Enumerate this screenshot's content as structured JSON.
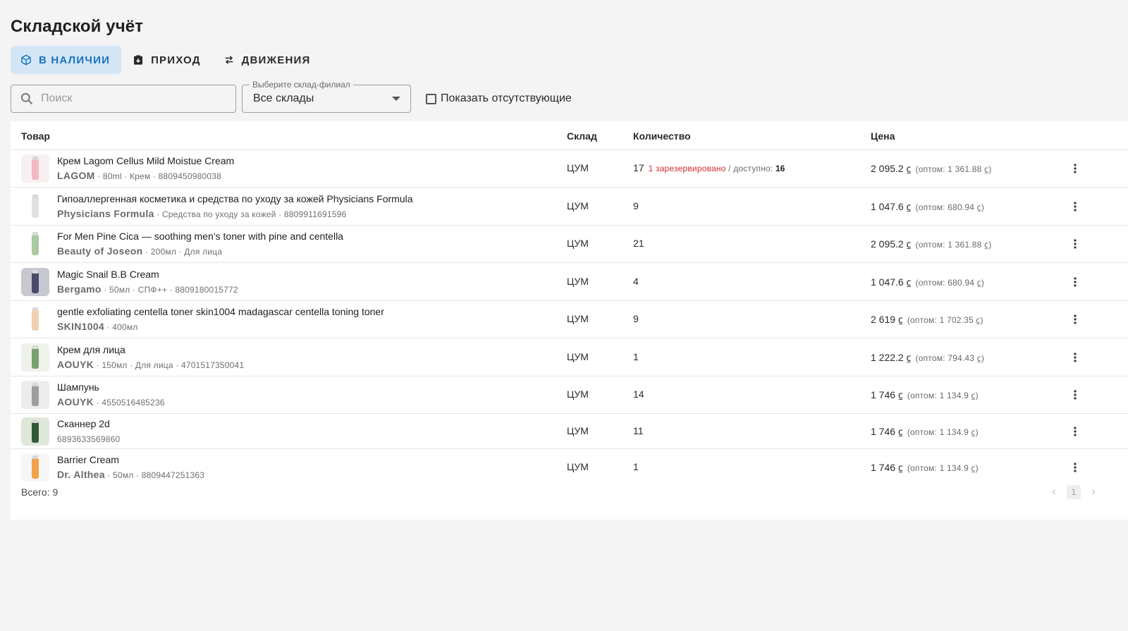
{
  "page": {
    "title": "Складской учёт"
  },
  "tabs": [
    {
      "label": "В НАЛИЧИИ",
      "icon": "box-icon",
      "active": true
    },
    {
      "label": "ПРИХОД",
      "icon": "clipboard-download-icon",
      "active": false
    },
    {
      "label": "ДВИЖЕНИЯ",
      "icon": "swap-arrows-icon",
      "active": false
    }
  ],
  "filters": {
    "search_placeholder": "Поиск",
    "warehouse_label": "Выберите склад-филиал",
    "warehouse_value": "Все склады",
    "show_missing_label": "Показать отсутствующие",
    "show_missing_checked": false
  },
  "table": {
    "headers": {
      "product": "Товар",
      "warehouse": "Склад",
      "quantity": "Количество",
      "price": "Цена"
    },
    "rows": [
      {
        "name": "Крем Lagom Cellus Mild Moistue Cream",
        "brand": "LAGOM",
        "meta": " · 80ml · Крем · 8809450980038",
        "warehouse": "ЦУМ",
        "qty": "17",
        "reserved": "1 зарезервировано",
        "avail_sep": " / доступно: ",
        "available": "16",
        "price": "2 095.2",
        "currency": "⃀",
        "wholesale_prefix": "(оптом: 1 361.88 ",
        "wholesale_suffix": ")",
        "thumb_color": "#f4b8c4",
        "thumb_bg": "#f6f0f0"
      },
      {
        "name": "Гипоаллергенная косметика и средства по уходу за кожей Physicians Formula",
        "brand": "Physicians Formula",
        "meta": " · Средства по уходу за кожей · 8809911691596",
        "warehouse": "ЦУМ",
        "qty": "9",
        "reserved": "",
        "avail_sep": "",
        "available": "",
        "price": "1 047.6",
        "currency": "⃀",
        "wholesale_prefix": "(оптом: 680.94 ",
        "wholesale_suffix": ")",
        "thumb_color": "#e0e0e0",
        "thumb_bg": "#ffffff"
      },
      {
        "name": "For Men Pine Cica — soothing men’s toner with pine and centella",
        "brand": "Beauty of Joseon",
        "meta": " · 200мл · Для лица",
        "warehouse": "ЦУМ",
        "qty": "21",
        "reserved": "",
        "avail_sep": "",
        "available": "",
        "price": "2 095.2",
        "currency": "⃀",
        "wholesale_prefix": "(оптом: 1 361.88 ",
        "wholesale_suffix": ")",
        "thumb_color": "#a9c9a0",
        "thumb_bg": "#ffffff"
      },
      {
        "name": "Magic Snail B.B Cream",
        "brand": "Bergamo",
        "meta": " · 50мл · СПФ++ · 8809180015772",
        "warehouse": "ЦУМ",
        "qty": "4",
        "reserved": "",
        "avail_sep": "",
        "available": "",
        "price": "1 047.6",
        "currency": "⃀",
        "wholesale_prefix": "(оптом: 680.94 ",
        "wholesale_suffix": ")",
        "thumb_color": "#4a4a6a",
        "thumb_bg": "#c8c8d0"
      },
      {
        "name": "gentle exfoliating centella toner skin1004 madagascar centella toning toner",
        "brand": "SKIN1004",
        "meta": " · 400мл",
        "warehouse": "ЦУМ",
        "qty": "9",
        "reserved": "",
        "avail_sep": "",
        "available": "",
        "price": "2 619",
        "currency": "⃀",
        "wholesale_prefix": "(оптом: 1 702.35 ",
        "wholesale_suffix": ")",
        "thumb_color": "#f0d0b0",
        "thumb_bg": "#ffffff"
      },
      {
        "name": "Крем для лица",
        "brand": "AOUYK",
        "meta": " · 150мл · Для лица · 4701517350041",
        "warehouse": "ЦУМ",
        "qty": "1",
        "reserved": "",
        "avail_sep": "",
        "available": "",
        "price": "1 222.2",
        "currency": "⃀",
        "wholesale_prefix": "(оптом: 794.43 ",
        "wholesale_suffix": ")",
        "thumb_color": "#7aa070",
        "thumb_bg": "#eef2ea"
      },
      {
        "name": "Шампунь",
        "brand": "AOUYK",
        "meta": " · 4550516485236",
        "warehouse": "ЦУМ",
        "qty": "14",
        "reserved": "",
        "avail_sep": "",
        "available": "",
        "price": "1 746",
        "currency": "⃀",
        "wholesale_prefix": "(оптом: 1 134.9 ",
        "wholesale_suffix": ")",
        "thumb_color": "#9e9e9e",
        "thumb_bg": "#ececec"
      },
      {
        "name": "Сканнер 2d",
        "brand": "",
        "meta": "6893633569860",
        "warehouse": "ЦУМ",
        "qty": "11",
        "reserved": "",
        "avail_sep": "",
        "available": "",
        "price": "1 746",
        "currency": "⃀",
        "wholesale_prefix": "(оптом: 1 134.9 ",
        "wholesale_suffix": ")",
        "thumb_color": "#2e5a3a",
        "thumb_bg": "#dfe8d8"
      },
      {
        "name": "Barrier Cream",
        "brand": "Dr. Althea",
        "meta": " · 50мл · 8809447251363",
        "warehouse": "ЦУМ",
        "qty": "1",
        "reserved": "",
        "avail_sep": "",
        "available": "",
        "price": "1 746",
        "currency": "⃀",
        "wholesale_prefix": "(оптом: 1 134.9 ",
        "wholesale_suffix": ")",
        "thumb_color": "#f2a04a",
        "thumb_bg": "#f6f6f6"
      }
    ]
  },
  "footer": {
    "total": "Всего: 9",
    "page": "1",
    "prev": "‹",
    "next": "›"
  },
  "colors": {
    "accent": "#1a73c0",
    "tab_active_bg": "#d4e6f6",
    "reserved": "#d32f2f"
  }
}
